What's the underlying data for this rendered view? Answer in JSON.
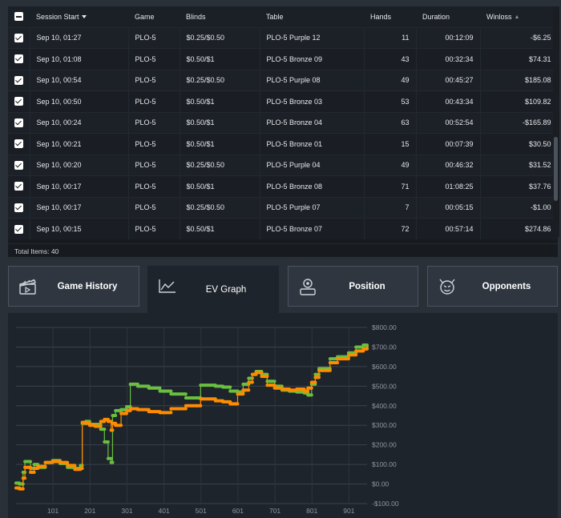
{
  "table": {
    "headers": {
      "session_start": "Session Start",
      "game": "Game",
      "blinds": "Blinds",
      "table": "Table",
      "hands": "Hands",
      "duration": "Duration",
      "winloss": "Winloss"
    },
    "rows": [
      {
        "start": "Sep 10, 01:27",
        "game": "PLO-5",
        "blinds": "$0.25/$0.50",
        "table": "PLO-5 Purple 12",
        "hands": "11",
        "duration": "00:12:09",
        "winloss": "-$6.25"
      },
      {
        "start": "Sep 10, 01:08",
        "game": "PLO-5",
        "blinds": "$0.50/$1",
        "table": "PLO-5 Bronze 09",
        "hands": "43",
        "duration": "00:32:34",
        "winloss": "$74.31"
      },
      {
        "start": "Sep 10, 00:54",
        "game": "PLO-5",
        "blinds": "$0.25/$0.50",
        "table": "PLO-5 Purple 08",
        "hands": "49",
        "duration": "00:45:27",
        "winloss": "$185.08"
      },
      {
        "start": "Sep 10, 00:50",
        "game": "PLO-5",
        "blinds": "$0.50/$1",
        "table": "PLO-5 Bronze 03",
        "hands": "53",
        "duration": "00:43:34",
        "winloss": "$109.82"
      },
      {
        "start": "Sep 10, 00:24",
        "game": "PLO-5",
        "blinds": "$0.50/$1",
        "table": "PLO-5 Bronze 04",
        "hands": "63",
        "duration": "00:52:54",
        "winloss": "-$165.89"
      },
      {
        "start": "Sep 10, 00:21",
        "game": "PLO-5",
        "blinds": "$0.50/$1",
        "table": "PLO-5 Bronze 01",
        "hands": "15",
        "duration": "00:07:39",
        "winloss": "$30.50"
      },
      {
        "start": "Sep 10, 00:20",
        "game": "PLO-5",
        "blinds": "$0.25/$0.50",
        "table": "PLO-5 Purple 04",
        "hands": "49",
        "duration": "00:46:32",
        "winloss": "$31.52"
      },
      {
        "start": "Sep 10, 00:17",
        "game": "PLO-5",
        "blinds": "$0.50/$1",
        "table": "PLO-5 Bronze 08",
        "hands": "71",
        "duration": "01:08:25",
        "winloss": "$37.76"
      },
      {
        "start": "Sep 10, 00:17",
        "game": "PLO-5",
        "blinds": "$0.25/$0.50",
        "table": "PLO-5 Purple 07",
        "hands": "7",
        "duration": "00:05:15",
        "winloss": "-$1.00"
      },
      {
        "start": "Sep 10, 00:15",
        "game": "PLO-5",
        "blinds": "$0.50/$1",
        "table": "PLO-5 Bronze 07",
        "hands": "72",
        "duration": "00:57:14",
        "winloss": "$274.86"
      }
    ],
    "total_items": "Total Items: 40"
  },
  "tabs": [
    {
      "label": "Game History",
      "icon": "clapperboard-icon",
      "active": false
    },
    {
      "label": "EV Graph",
      "icon": "area-chart-icon",
      "active": true
    },
    {
      "label": "Position",
      "icon": "position-icon",
      "active": false
    },
    {
      "label": "Opponents",
      "icon": "devil-face-icon",
      "active": false
    }
  ],
  "colors": {
    "winloss_line": "#ff8c00",
    "ev_line": "#6abf40",
    "background": "#1e242b"
  },
  "chart_data": {
    "type": "line",
    "x_ticks": [
      "101",
      "201",
      "301",
      "401",
      "501",
      "601",
      "701",
      "801",
      "901"
    ],
    "y_ticks": [
      "$800.00",
      "$700.00",
      "$600.00",
      "$500.00",
      "$400.00",
      "$300.00",
      "$200.00",
      "$100.00",
      "$0.00",
      "-$100.00"
    ],
    "xlim": [
      1,
      950
    ],
    "ylim": [
      -100,
      800
    ],
    "grid": true,
    "series": [
      {
        "color": "#6abf40",
        "x": [
          1,
          10,
          20,
          25,
          40,
          50,
          60,
          80,
          100,
          120,
          140,
          160,
          175,
          180,
          190,
          200,
          215,
          230,
          240,
          250,
          258,
          262,
          270,
          285,
          300,
          310,
          330,
          360,
          390,
          420,
          460,
          500,
          540,
          560,
          580,
          600,
          615,
          630,
          640,
          650,
          665,
          680,
          700,
          720,
          740,
          760,
          780,
          790,
          800,
          810,
          820,
          850,
          870,
          900,
          920,
          940,
          950
        ],
        "y": [
          5,
          0,
          60,
          115,
          80,
          100,
          85,
          110,
          120,
          105,
          85,
          80,
          95,
          310,
          320,
          305,
          305,
          280,
          215,
          130,
          110,
          350,
          375,
          380,
          395,
          510,
          500,
          490,
          475,
          460,
          440,
          505,
          500,
          495,
          475,
          470,
          510,
          540,
          560,
          575,
          560,
          525,
          500,
          480,
          475,
          470,
          465,
          455,
          510,
          560,
          590,
          640,
          650,
          670,
          700,
          710,
          705
        ]
      },
      {
        "color": "#ff8c00",
        "x": [
          1,
          10,
          20,
          25,
          40,
          50,
          60,
          80,
          100,
          120,
          140,
          160,
          175,
          180,
          190,
          200,
          215,
          230,
          240,
          250,
          258,
          262,
          270,
          285,
          300,
          310,
          330,
          360,
          390,
          420,
          460,
          500,
          540,
          560,
          580,
          600,
          615,
          630,
          640,
          650,
          665,
          680,
          700,
          720,
          740,
          760,
          780,
          790,
          800,
          810,
          820,
          850,
          870,
          900,
          920,
          940,
          950
        ],
        "y": [
          -20,
          -25,
          30,
          85,
          60,
          80,
          90,
          110,
          115,
          110,
          95,
          75,
          80,
          315,
          310,
          300,
          295,
          320,
          330,
          320,
          275,
          310,
          300,
          360,
          375,
          385,
          380,
          370,
          365,
          385,
          400,
          435,
          425,
          420,
          410,
          460,
          480,
          520,
          560,
          570,
          550,
          505,
          490,
          485,
          480,
          485,
          475,
          490,
          520,
          545,
          580,
          620,
          640,
          660,
          680,
          690,
          695
        ]
      }
    ]
  }
}
